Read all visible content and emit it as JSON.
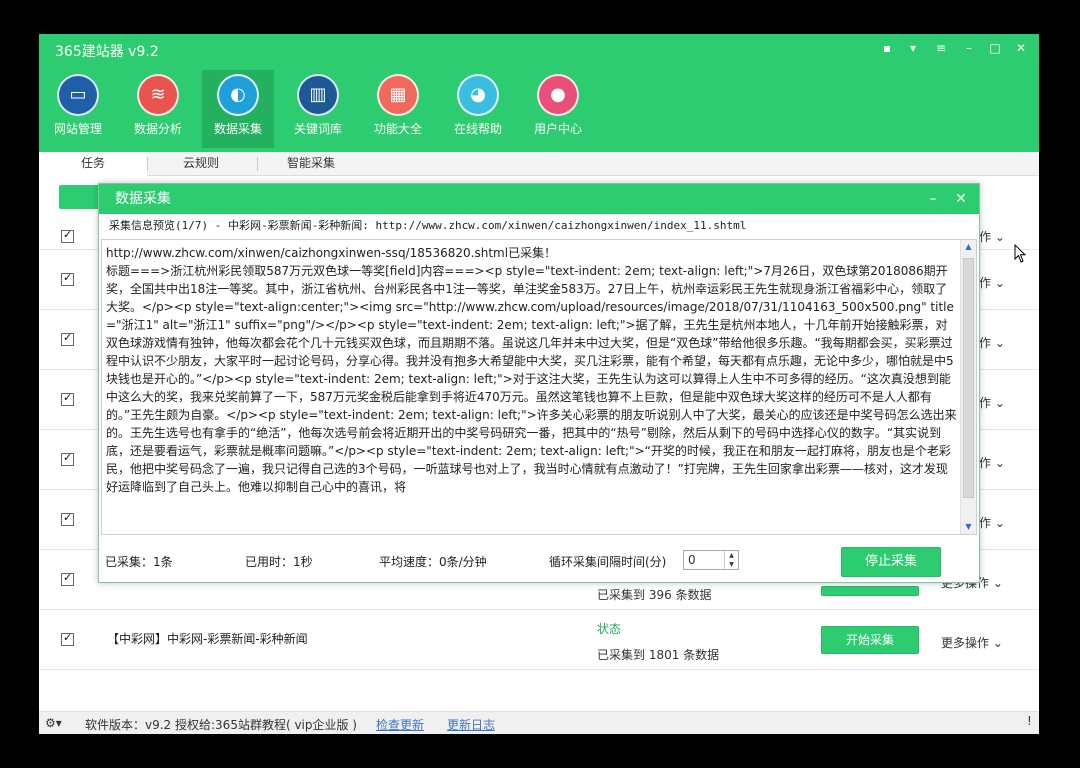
{
  "app": {
    "title": "365建站器 v9.2"
  },
  "window_controls": [
    {
      "name": "message-icon",
      "glyph": "▪"
    },
    {
      "name": "skin-icon",
      "glyph": "▾"
    },
    {
      "name": "menu-icon",
      "glyph": "≡"
    },
    {
      "name": "minimize-icon",
      "glyph": "–"
    },
    {
      "name": "maximize-icon",
      "glyph": "□"
    },
    {
      "name": "close-icon",
      "glyph": "✕"
    }
  ],
  "toolbar": [
    {
      "label": "网站管理",
      "icon": "monitor-icon",
      "glyph": "▭",
      "color": "#1f5fa8"
    },
    {
      "label": "数据分析",
      "icon": "database-icon",
      "glyph": "≋",
      "color": "#e8554e"
    },
    {
      "label": "数据采集",
      "icon": "globe-icon",
      "glyph": "◐",
      "color": "#1fa0d8"
    },
    {
      "label": "关键词库",
      "icon": "book-icon",
      "glyph": "▥",
      "color": "#1b5a94"
    },
    {
      "label": "功能大全",
      "icon": "grid-icon",
      "glyph": "▦",
      "color": "#f06a5c"
    },
    {
      "label": "在线帮助",
      "icon": "headset-icon",
      "glyph": "◕",
      "color": "#3bbde0"
    },
    {
      "label": "用户中心",
      "icon": "user-icon",
      "glyph": "●",
      "color": "#e8507a"
    }
  ],
  "tabs": [
    "任务",
    "云规则",
    "智能采集"
  ],
  "rows": [
    {
      "more": "作"
    },
    {
      "more": "作"
    },
    {
      "more": "作"
    },
    {
      "more": "作"
    },
    {
      "more": "作"
    },
    {
      "more": "作"
    },
    {
      "more": "更多操作",
      "collected": "已采集到 396 条数据"
    },
    {
      "name": "【中彩网】中彩网-彩票新闻-彩种新闻",
      "status": "状态",
      "collected": "已采集到 1801 条数据",
      "button": "开始采集",
      "more": "更多操作"
    }
  ],
  "statusbar": {
    "version_text": "软件版本：v9.2",
    "license_text": "授权给:365站群教程( vip企业版 )",
    "check_update": "检查更新",
    "update_log": "更新日志"
  },
  "dialog": {
    "title": "数据采集",
    "preview_header": "采集信息预览(1/7) - 中彩网-彩票新闻-彩种新闻: http://www.zhcw.com/xinwen/caizhongxinwen/index_11.shtml",
    "content": "http://www.zhcw.com/xinwen/caizhongxinwen-ssq/18536820.shtml已采集！\n标题===>浙江杭州彩民领取587万元双色球一等奖[field]内容===><p style=\"text-indent: 2em; text-align: left;\">7月26日，双色球第2018086期开奖，全国共中出18注一等奖。其中，浙江省杭州、台州彩民各中1注一等奖，单注奖金583万。27日上午，杭州幸运彩民王先生就现身浙江省福彩中心，领取了大奖。</p><p style=\"text-align:center;\"><img src=\"http://www.zhcw.com/upload/resources/image/2018/07/31/1104163_500x500.png\" title=\"浙江1\" alt=\"浙江1\" suffix=\"png\"/></p><p style=\"text-indent: 2em; text-align: left;\">据了解，王先生是杭州本地人，十几年前开始接触彩票，对双色球游戏情有独钟，他每次都会花个几十元钱买双色球，而且期期不落。虽说这几年并未中过大奖，但是“双色球”带给他很多乐趣。“我每期都会买，买彩票过程中认识不少朋友，大家平时一起讨论号码，分享心得。我并没有抱多大希望能中大奖，买几注彩票，能有个希望，每天都有点乐趣，无论中多少，哪怕就是中5块钱也是开心的。”</p><p style=\"text-indent: 2em; text-align: left;\">对于这注大奖，王先生认为这可以算得上人生中不可多得的经历。“这次真没想到能中这么大的奖，我来兑奖前算了一下，587万元奖金税后能拿到手将近470万元。虽然这笔钱也算不上巨款，但是能中双色球大奖这样的经历可不是人人都有的。”王先生颇为自豪。</p><p style=\"text-indent: 2em; text-align: left;\">许多关心彩票的朋友听说别人中了大奖，最关心的应该还是中奖号码怎么选出来的。王先生选号也有拿手的“绝活”，他每次选号前会将近期开出的中奖号码研究一番，把其中的“热号”剔除，然后从剩下的号码中选择心仪的数字。“其实说到底，还是要看运气，彩票就是概率问题嘛。”</p><p style=\"text-indent: 2em; text-align: left;\">“开奖的时候，我正在和朋友一起打麻将，朋友也是个老彩民，他把中奖号码念了一遍，我只记得自己选的3个号码，一听蓝球号也对上了，我当时心情就有点激动了！”打完牌，王先生回家拿出彩票——核对，这才发现好运降临到了自己头上。他难以抑制自己心中的喜讯，将",
    "collected_label": "已采集：1条",
    "elapsed_label": "已用时：1秒",
    "speed_label": "平均速度：0条/分钟",
    "interval_label": "循环采集间隔时间(分)",
    "interval_value": "0",
    "stop_button": "停止采集"
  },
  "colors": {
    "accent": "#2ecc71",
    "status_green": "#2aa55c",
    "link": "#3a76c4"
  }
}
